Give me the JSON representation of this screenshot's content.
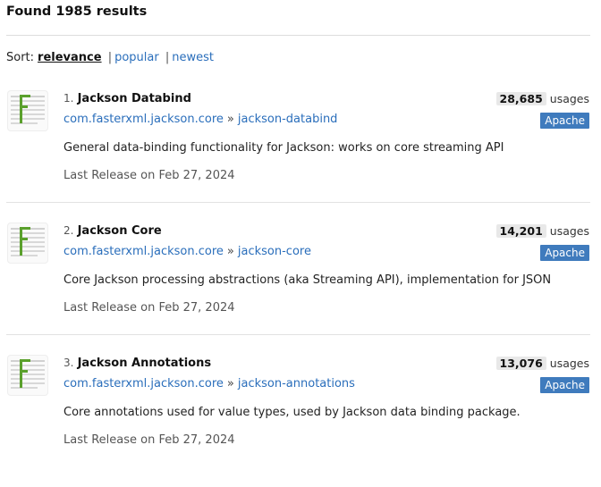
{
  "heading": "Found 1985 results",
  "sort": {
    "label": "Sort:",
    "options": [
      "relevance",
      "popular",
      "newest"
    ],
    "selected": "relevance"
  },
  "results": [
    {
      "index": "1.",
      "name": "Jackson Databind",
      "group": "com.fasterxml.jackson.core",
      "artifact": "jackson-databind",
      "description": "General data-binding functionality for Jackson: works on core streaming API",
      "release": "Last Release on Feb 27, 2024",
      "usages_count": "28,685",
      "usages_label": "usages",
      "license": "Apache"
    },
    {
      "index": "2.",
      "name": "Jackson Core",
      "group": "com.fasterxml.jackson.core",
      "artifact": "jackson-core",
      "description": "Core Jackson processing abstractions (aka Streaming API), implementation for JSON",
      "release": "Last Release on Feb 27, 2024",
      "usages_count": "14,201",
      "usages_label": "usages",
      "license": "Apache"
    },
    {
      "index": "3.",
      "name": "Jackson Annotations",
      "group": "com.fasterxml.jackson.core",
      "artifact": "jackson-annotations",
      "description": "Core annotations used for value types, used by Jackson data binding package.",
      "release": "Last Release on Feb 27, 2024",
      "usages_count": "13,076",
      "usages_label": "usages",
      "license": "Apache"
    }
  ],
  "colors": {
    "link": "#2a6ebb",
    "license_badge": "#3f7bbd",
    "logo_green": "#5aa02c"
  },
  "logo_icon": "jackson-logo-icon"
}
